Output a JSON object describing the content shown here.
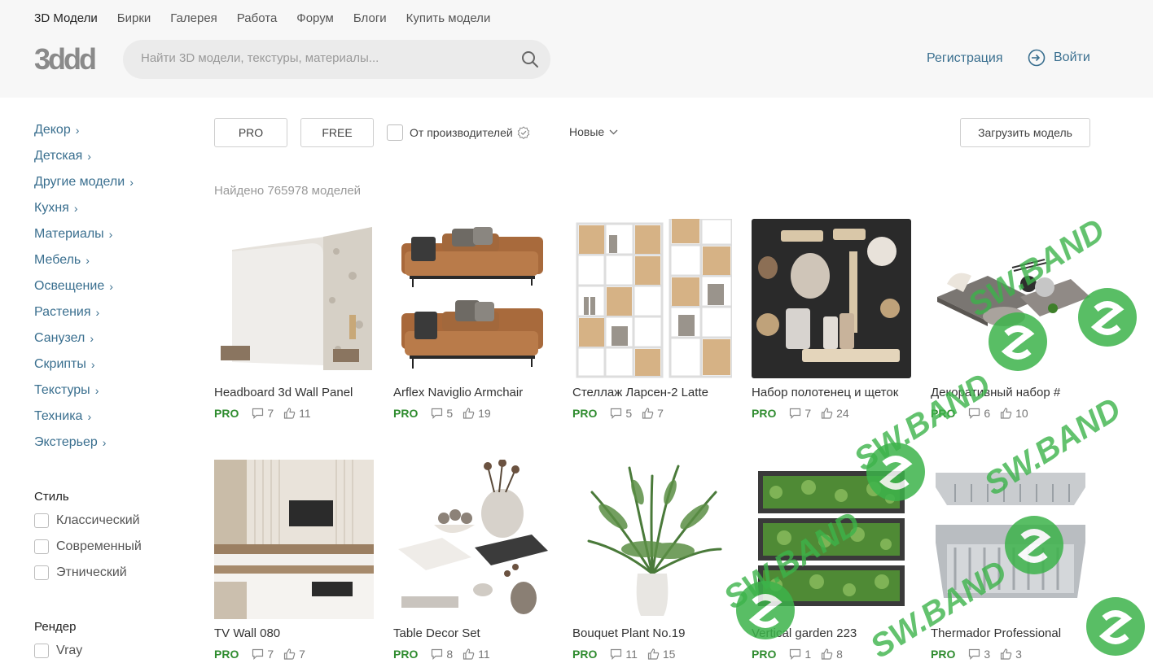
{
  "nav": [
    "3D Модели",
    "Бирки",
    "Галерея",
    "Работа",
    "Форум",
    "Блоги",
    "Купить модели"
  ],
  "logo_text": "3ddd",
  "search": {
    "placeholder": "Найти 3D модели, текстуры, материалы..."
  },
  "auth": {
    "register": "Регистрация",
    "login": "Войти"
  },
  "categories": [
    "Декор",
    "Детская",
    "Другие модели",
    "Кухня",
    "Материалы",
    "Мебель",
    "Освещение",
    "Растения",
    "Санузел",
    "Скрипты",
    "Текстуры",
    "Техника",
    "Экстерьер"
  ],
  "filters": {
    "style_title": "Стиль",
    "styles": [
      "Классический",
      "Современный",
      "Этнический"
    ],
    "render_title": "Рендер",
    "renders": [
      "Vray"
    ]
  },
  "toolbar": {
    "pro": "PRO",
    "free": "FREE",
    "manufacturers": "От производителей",
    "sort": "Новые",
    "upload": "Загрузить модель"
  },
  "found_text": "Найдено 765978 моделей",
  "badge": "PRO",
  "models": [
    {
      "title": "Headboard 3d Wall Panel",
      "comments": "7",
      "likes": "11"
    },
    {
      "title": "Arflex Naviglio Armchair",
      "comments": "5",
      "likes": "19"
    },
    {
      "title": "Стеллаж Ларсен-2 Latte",
      "comments": "5",
      "likes": "7"
    },
    {
      "title": "Набор полотенец и щеток",
      "comments": "7",
      "likes": "24"
    },
    {
      "title": "Декоративный набор #",
      "comments": "6",
      "likes": "10"
    },
    {
      "title": "TV Wall 080",
      "comments": "7",
      "likes": "7"
    },
    {
      "title": "Table Decor Set",
      "comments": "8",
      "likes": "11"
    },
    {
      "title": "Bouquet Plant No.19",
      "comments": "11",
      "likes": "15"
    },
    {
      "title": "Vertical garden 223",
      "comments": "1",
      "likes": "8"
    },
    {
      "title": "Thermador Professional",
      "comments": "3",
      "likes": "3"
    }
  ],
  "watermark": "SW.BAND",
  "colors": {
    "link": "#3a6f8f",
    "pro": "#2f8c2f",
    "watermark": "#3cb34a"
  }
}
